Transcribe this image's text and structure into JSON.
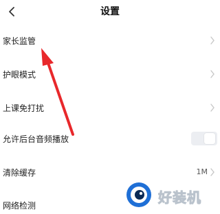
{
  "header": {
    "title": "设置"
  },
  "settings": [
    {
      "label": "家长监管"
    },
    {
      "label": "护眼模式"
    },
    {
      "label": "上课免打扰"
    },
    {
      "label": "允许后台音频播放",
      "toggle": "off"
    },
    {
      "label": "清除缓存",
      "value": "1M"
    },
    {
      "label": "网络检测"
    }
  ],
  "watermark": {
    "text": "好装机"
  },
  "colors": {
    "arrow": "#e8282b",
    "chevron": "#c8c8c8"
  }
}
